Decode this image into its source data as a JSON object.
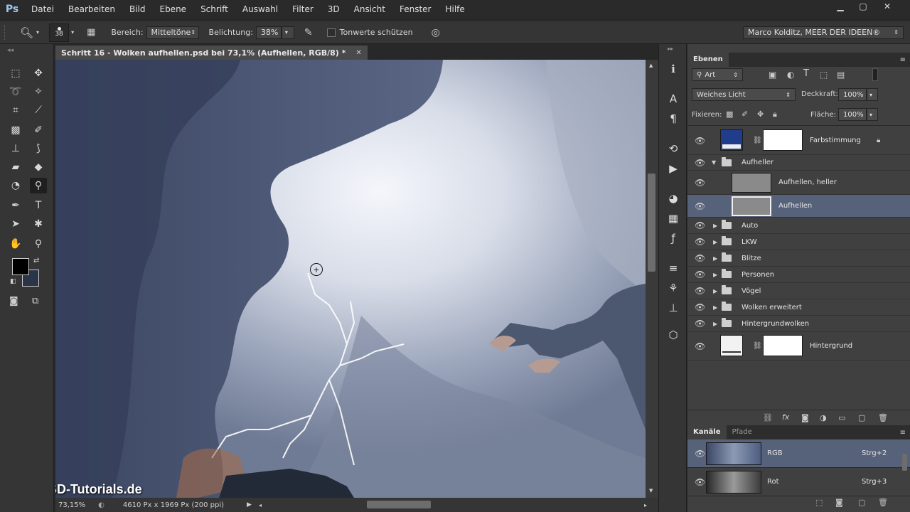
{
  "app": {
    "logo": "Ps",
    "menu": [
      "Datei",
      "Bearbeiten",
      "Bild",
      "Ebene",
      "Schrift",
      "Auswahl",
      "Filter",
      "3D",
      "Ansicht",
      "Fenster",
      "Hilfe"
    ],
    "window_controls": [
      "minimize-icon",
      "restore-icon",
      "close-icon"
    ]
  },
  "options": {
    "brush_size": "38",
    "range_label": "Bereich:",
    "range_value": "Mitteltöne",
    "exposure_label": "Belichtung:",
    "exposure_value": "38%",
    "protect_tones_label": "Tonwerte schützen",
    "workspace": "Marco Kolditz, MEER DER IDEEN®"
  },
  "document": {
    "tab_title": "Schritt 16 - Wolken aufhellen.psd bei 73,1% (Aufhellen, RGB/8) *",
    "zoom": "73,15%",
    "doc_info": "4610 Px x 1969 Px (200 ppi)",
    "watermark": "PSD-Tutorials.de"
  },
  "layers_panel": {
    "tab": "Ebenen",
    "filter_kind": "Art",
    "blend_mode": "Weiches Licht",
    "opacity_label": "Deckkraft:",
    "opacity_value": "100%",
    "lock_label": "Fixieren:",
    "fill_label": "Fläche:",
    "fill_value": "100%",
    "layers": [
      {
        "name": "Farbstimmung",
        "type": "adjustment",
        "locked": true
      },
      {
        "name": "Aufheller",
        "type": "group-open"
      },
      {
        "name": "Aufhellen, heller",
        "type": "layer"
      },
      {
        "name": "Aufhellen",
        "type": "layer",
        "selected": true
      },
      {
        "name": "Auto",
        "type": "group"
      },
      {
        "name": "LKW",
        "type": "group"
      },
      {
        "name": "Blitze",
        "type": "group"
      },
      {
        "name": "Personen",
        "type": "group"
      },
      {
        "name": "Vögel",
        "type": "group"
      },
      {
        "name": "Wolken erweitert",
        "type": "group"
      },
      {
        "name": "Hintergrundwolken",
        "type": "group"
      },
      {
        "name": "Hintergrund",
        "type": "adjustment"
      }
    ]
  },
  "channels_panel": {
    "tabs": [
      "Kanäle",
      "Pfade"
    ],
    "channels": [
      {
        "name": "RGB",
        "shortcut": "Strg+2"
      },
      {
        "name": "Rot",
        "shortcut": "Strg+3"
      }
    ]
  },
  "colors": {
    "accent_selected": "#56617a",
    "farbstimmung_thumb": "#1f3d8a"
  }
}
